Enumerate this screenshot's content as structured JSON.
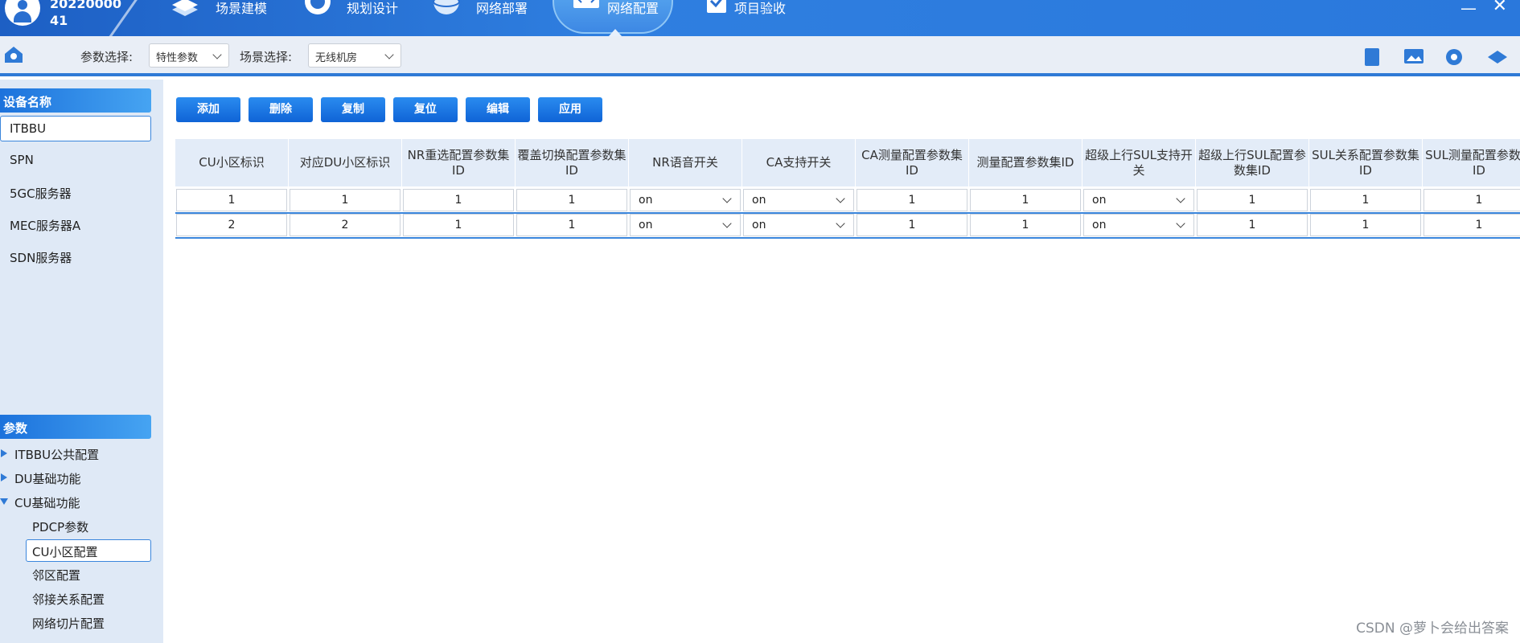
{
  "header": {
    "user_line1": "20220000",
    "user_line2": "41",
    "tabs": [
      {
        "label": "场景建模",
        "icon": "layers-icon"
      },
      {
        "label": "规划设计",
        "icon": "compass-icon"
      },
      {
        "label": "网络部署",
        "icon": "globe-icon"
      },
      {
        "label": "网络配置",
        "icon": "monitor-code-icon"
      },
      {
        "label": "项目验收",
        "icon": "checklist-icon"
      }
    ],
    "minimize": "—",
    "close": "✕"
  },
  "toolbar": {
    "param_label": "参数选择:",
    "param_value": "特性参数",
    "scene_label": "场景选择:",
    "scene_value": "无线机房"
  },
  "sidebar": {
    "device_header": "设备名称",
    "devices": [
      "ITBBU",
      "SPN",
      "5GC服务器",
      "MEC服务器A",
      "SDN服务器"
    ],
    "param_header": "参数",
    "tree": [
      {
        "label": "ITBBU公共配置",
        "expanded": false
      },
      {
        "label": "DU基础功能",
        "expanded": false
      },
      {
        "label": "CU基础功能",
        "expanded": true
      }
    ],
    "sub_items": [
      "PDCP参数",
      "CU小区配置",
      "邻区配置",
      "邻接关系配置",
      "网络切片配置"
    ]
  },
  "actions": [
    "添加",
    "删除",
    "复制",
    "复位",
    "编辑",
    "应用"
  ],
  "table": {
    "headers": [
      "CU小区标识",
      "对应DU小区标识",
      "NR重选配置参数集ID",
      "覆盖切换配置参数集ID",
      "NR语音开关",
      "CA支持开关",
      "CA测量配置参数集ID",
      "测量配置参数集ID",
      "超级上行SUL支持开关",
      "超级上行SUL配置参数集ID",
      "SUL关系配置参数集ID",
      "SUL测量配置参数集ID"
    ],
    "rows": [
      [
        "1",
        "1",
        "1",
        "1",
        "on",
        "on",
        "1",
        "1",
        "on",
        "1",
        "1",
        "1"
      ],
      [
        "2",
        "2",
        "1",
        "1",
        "on",
        "on",
        "1",
        "1",
        "on",
        "1",
        "1",
        "1"
      ]
    ]
  },
  "colors": {
    "accent": "#2f7ad6",
    "sidebar_bg": "#dfe9f6",
    "header_bg": "#e3ecf8"
  },
  "watermark": "CSDN @萝卜会给出答案"
}
